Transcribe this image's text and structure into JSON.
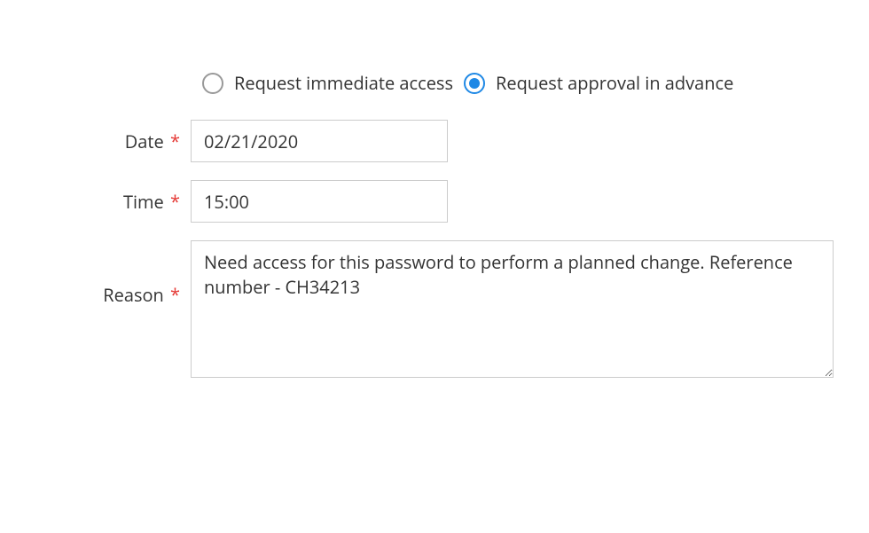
{
  "radios": {
    "immediate": {
      "label": "Request immediate access",
      "selected": false
    },
    "advance": {
      "label": "Request approval in advance",
      "selected": true
    }
  },
  "fields": {
    "date": {
      "label": "Date",
      "value": "02/21/2020"
    },
    "time": {
      "label": "Time",
      "value": "15:00"
    },
    "reason": {
      "label": "Reason",
      "value": "Need access for this password to perform a planned change. Reference number - CH34213"
    }
  },
  "required_mark": "*"
}
